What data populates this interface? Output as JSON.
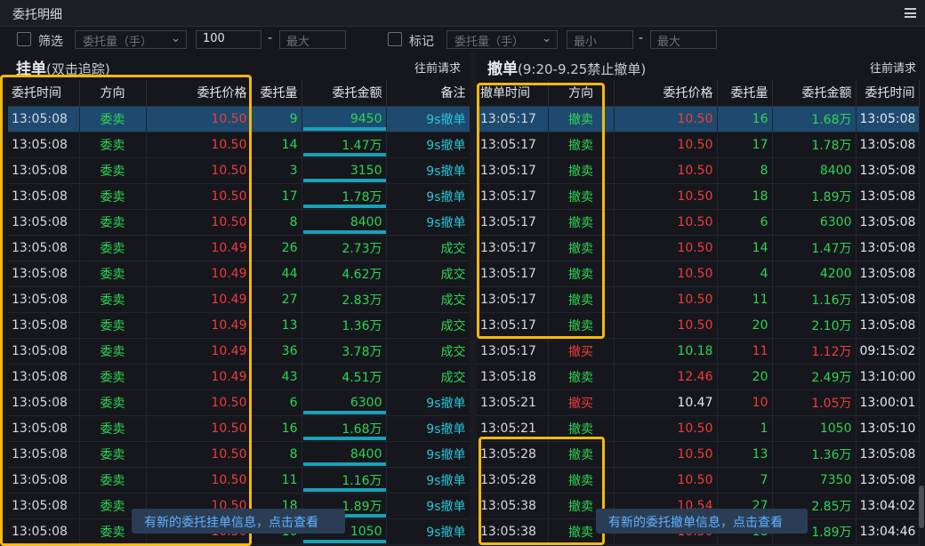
{
  "window": {
    "title": "委托明细"
  },
  "filters": {
    "left_checkbox_label": "筛选",
    "left_select": "委托量（手）",
    "left_min_value": "100",
    "left_max_placeholder": "最大",
    "right_checkbox_label": "标记",
    "right_select": "委托量（手）",
    "right_min_placeholder": "最小",
    "right_max_placeholder": "最大",
    "range_sep": "-"
  },
  "left_panel": {
    "title": "挂单",
    "subtitle": "(双击追踪)",
    "request_label": "往前请求",
    "columns": [
      "委托时间",
      "方向",
      "委托价格",
      "委托量",
      "委托金额",
      "备注"
    ],
    "rows": [
      {
        "time": "13:05:08",
        "dir": "委卖",
        "price": "10.50",
        "qty": "9",
        "amount": "9450",
        "note": "9s撤单"
      },
      {
        "time": "13:05:08",
        "dir": "委卖",
        "price": "10.50",
        "qty": "14",
        "amount": "1.47万",
        "note": "9s撤单"
      },
      {
        "time": "13:05:08",
        "dir": "委卖",
        "price": "10.50",
        "qty": "3",
        "amount": "3150",
        "note": "9s撤单"
      },
      {
        "time": "13:05:08",
        "dir": "委卖",
        "price": "10.50",
        "qty": "17",
        "amount": "1.78万",
        "note": "9s撤单"
      },
      {
        "time": "13:05:08",
        "dir": "委卖",
        "price": "10.50",
        "qty": "8",
        "amount": "8400",
        "note": "9s撤单"
      },
      {
        "time": "13:05:08",
        "dir": "委卖",
        "price": "10.49",
        "qty": "26",
        "amount": "2.73万",
        "note": "成交"
      },
      {
        "time": "13:05:08",
        "dir": "委卖",
        "price": "10.49",
        "qty": "44",
        "amount": "4.62万",
        "note": "成交"
      },
      {
        "time": "13:05:08",
        "dir": "委卖",
        "price": "10.49",
        "qty": "27",
        "amount": "2.83万",
        "note": "成交"
      },
      {
        "time": "13:05:08",
        "dir": "委卖",
        "price": "10.49",
        "qty": "13",
        "amount": "1.36万",
        "note": "成交"
      },
      {
        "time": "13:05:08",
        "dir": "委卖",
        "price": "10.49",
        "qty": "36",
        "amount": "3.78万",
        "note": "成交"
      },
      {
        "time": "13:05:08",
        "dir": "委卖",
        "price": "10.49",
        "qty": "43",
        "amount": "4.51万",
        "note": "成交"
      },
      {
        "time": "13:05:08",
        "dir": "委卖",
        "price": "10.50",
        "qty": "6",
        "amount": "6300",
        "note": "9s撤单"
      },
      {
        "time": "13:05:08",
        "dir": "委卖",
        "price": "10.50",
        "qty": "16",
        "amount": "1.68万",
        "note": "9s撤单"
      },
      {
        "time": "13:05:08",
        "dir": "委卖",
        "price": "10.50",
        "qty": "8",
        "amount": "8400",
        "note": "9s撤单"
      },
      {
        "time": "13:05:08",
        "dir": "委卖",
        "price": "10.50",
        "qty": "11",
        "amount": "1.16万",
        "note": "9s撤单"
      },
      {
        "time": "13:05:08",
        "dir": "委卖",
        "price": "10.50",
        "qty": "18",
        "amount": "1.89万",
        "note": "9s撤单"
      },
      {
        "time": "13:05:08",
        "dir": "委卖",
        "price": "10.50",
        "qty": "10",
        "amount": "1050",
        "note": "9s撤单"
      }
    ],
    "toast": "有新的委托挂单信息，点击查看"
  },
  "right_panel": {
    "title": "撤单",
    "subtitle": "(9:20-9.25禁止撤单)",
    "request_label": "往前请求",
    "columns": [
      "撤单时间",
      "方向",
      "委托价格",
      "委托量",
      "委托金额",
      "委托时间"
    ],
    "rows": [
      {
        "time": "13:05:17",
        "dir": "撤卖",
        "price": "10.50",
        "qty": "16",
        "amount": "1.68万",
        "otime": "13:05:08"
      },
      {
        "time": "13:05:17",
        "dir": "撤卖",
        "price": "10.50",
        "qty": "17",
        "amount": "1.78万",
        "otime": "13:05:08"
      },
      {
        "time": "13:05:17",
        "dir": "撤卖",
        "price": "10.50",
        "qty": "8",
        "amount": "8400",
        "otime": "13:05:08"
      },
      {
        "time": "13:05:17",
        "dir": "撤卖",
        "price": "10.50",
        "qty": "18",
        "amount": "1.89万",
        "otime": "13:05:08"
      },
      {
        "time": "13:05:17",
        "dir": "撤卖",
        "price": "10.50",
        "qty": "6",
        "amount": "6300",
        "otime": "13:05:08"
      },
      {
        "time": "13:05:17",
        "dir": "撤卖",
        "price": "10.50",
        "qty": "14",
        "amount": "1.47万",
        "otime": "13:05:08"
      },
      {
        "time": "13:05:17",
        "dir": "撤卖",
        "price": "10.50",
        "qty": "4",
        "amount": "4200",
        "otime": "13:05:08"
      },
      {
        "time": "13:05:17",
        "dir": "撤卖",
        "price": "10.50",
        "qty": "11",
        "amount": "1.16万",
        "otime": "13:05:08"
      },
      {
        "time": "13:05:17",
        "dir": "撤卖",
        "price": "10.50",
        "qty": "20",
        "amount": "2.10万",
        "otime": "13:05:08"
      },
      {
        "time": "13:05:17",
        "dir": "撤买",
        "price": "10.18",
        "qty": "11",
        "amount": "1.12万",
        "otime": "09:15:02"
      },
      {
        "time": "13:05:18",
        "dir": "撤卖",
        "price": "12.46",
        "qty": "20",
        "amount": "2.49万",
        "otime": "13:10:00"
      },
      {
        "time": "13:05:21",
        "dir": "撤买",
        "price": "10.47",
        "qty": "10",
        "amount": "1.05万",
        "otime": "13:00:01"
      },
      {
        "time": "13:05:21",
        "dir": "撤卖",
        "price": "10.50",
        "qty": "1",
        "amount": "1050",
        "otime": "13:05:10"
      },
      {
        "time": "13:05:28",
        "dir": "撤卖",
        "price": "10.50",
        "qty": "13",
        "amount": "1.36万",
        "otime": "13:05:08"
      },
      {
        "time": "13:05:28",
        "dir": "撤卖",
        "price": "10.50",
        "qty": "7",
        "amount": "7350",
        "otime": "13:05:08"
      },
      {
        "time": "13:05:38",
        "dir": "撤卖",
        "price": "10.54",
        "qty": "27",
        "amount": "2.85万",
        "otime": "13:04:02"
      },
      {
        "time": "13:05:38",
        "dir": "撤卖",
        "price": "10.50",
        "qty": "18",
        "amount": "1.89万",
        "otime": "13:04:46"
      }
    ],
    "toast": "有新的委托撤单信息，点击查看"
  },
  "colors": {
    "red": "#f03b3b",
    "green": "#2fd455",
    "cyan": "#2ac4d6",
    "highlight": "#f5b80e",
    "selected_row": "#1d4a6e"
  }
}
